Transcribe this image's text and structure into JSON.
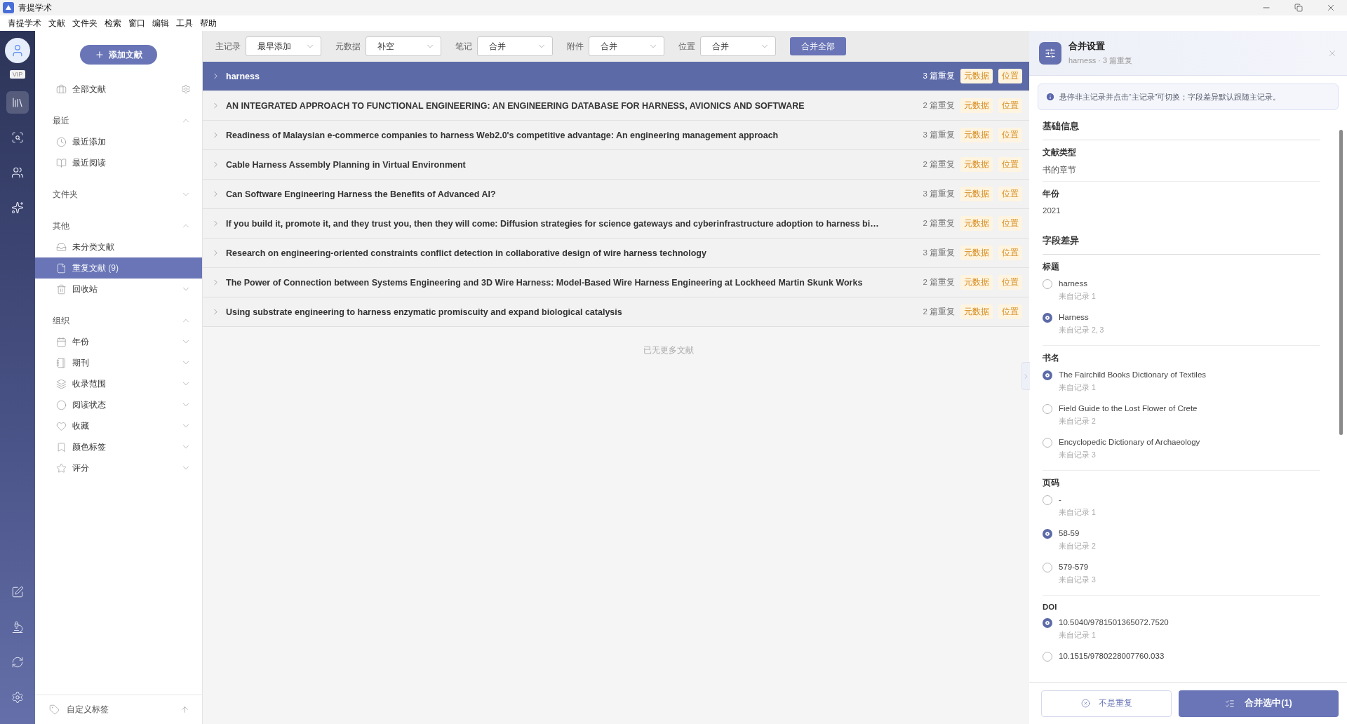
{
  "window": {
    "title": "青提学术"
  },
  "menu": [
    "青提学术",
    "文献",
    "文件夹",
    "检索",
    "窗口",
    "编辑",
    "工具",
    "帮助"
  ],
  "rail": {
    "badge": "VIP",
    "top": [
      {
        "selected": true
      },
      {
        "selected": false
      },
      {
        "selected": false
      },
      {
        "selected": false
      }
    ],
    "bottom": [
      {
        "selected": false
      },
      {
        "selected": false
      },
      {
        "selected": false
      },
      {
        "selected": false
      }
    ]
  },
  "sidebar": {
    "add_button": "添加文献",
    "all_label": "全部文献",
    "sections": [
      {
        "title": "最近",
        "expanded": true,
        "items": [
          {
            "label": "最近添加",
            "selected": false,
            "expandable": false
          },
          {
            "label": "最近阅读",
            "selected": false,
            "expandable": false
          }
        ]
      },
      {
        "title": "文件夹",
        "expanded": false
      },
      {
        "title": "其他",
        "expanded": true,
        "items": [
          {
            "label": "未分类文献",
            "selected": false,
            "expandable": false
          },
          {
            "label": "重复文献",
            "count": "(9)",
            "selected": true,
            "expandable": false
          },
          {
            "label": "回收站",
            "selected": false,
            "expandable": true
          }
        ]
      },
      {
        "title": "组织",
        "expanded": true,
        "items": [
          {
            "label": "年份",
            "selected": false,
            "expandable": true
          },
          {
            "label": "期刊",
            "selected": false,
            "expandable": true
          },
          {
            "label": "收录范围",
            "selected": false,
            "expandable": true
          },
          {
            "label": "阅读状态",
            "selected": false,
            "expandable": true
          },
          {
            "label": "收藏",
            "selected": false,
            "expandable": true
          },
          {
            "label": "颜色标签",
            "selected": false,
            "expandable": true
          },
          {
            "label": "评分",
            "selected": false,
            "expandable": true
          }
        ]
      }
    ],
    "footer": "自定义标签"
  },
  "toolbar": {
    "filters": [
      {
        "label": "主记录",
        "value": "最早添加"
      },
      {
        "label": "元数据",
        "value": "补空"
      },
      {
        "label": "笔记",
        "value": "合并"
      },
      {
        "label": "附件",
        "value": "合并"
      },
      {
        "label": "位置",
        "value": "合并"
      }
    ],
    "merge_all": "合并全部"
  },
  "groups": [
    {
      "title": "harness",
      "count": "3 篇重复",
      "tags": [
        "元数据",
        "位置"
      ],
      "selected": true,
      "expanded": false
    },
    {
      "title": "AN INTEGRATED APPROACH TO FUNCTIONAL ENGINEERING: AN ENGINEERING DATABASE FOR HARNESS, AVIONICS AND SOFTWARE",
      "count": "2 篇重复",
      "tags": [
        "元数据",
        "位置"
      ],
      "selected": false,
      "expanded": false
    },
    {
      "title": "Readiness of Malaysian e-commerce companies to harness Web2.0's competitive advantage: An engineering management approach",
      "count": "3 篇重复",
      "tags": [
        "元数据",
        "位置"
      ],
      "selected": false,
      "expanded": false
    },
    {
      "title": "Cable Harness Assembly Planning in Virtual Environment",
      "count": "2 篇重复",
      "tags": [
        "元数据",
        "位置"
      ],
      "selected": false,
      "expanded": false
    },
    {
      "title": "Can Software Engineering Harness the Benefits of Advanced AI?",
      "count": "3 篇重复",
      "tags": [
        "元数据",
        "位置"
      ],
      "selected": false,
      "expanded": false
    },
    {
      "title": "If you build it, promote it, and they trust you, then they will come: Diffusion strategies for science gateways and cyberinfrastructure adoption to harness bi…",
      "count": "2 篇重复",
      "tags": [
        "元数据",
        "位置"
      ],
      "selected": false,
      "expanded": false
    },
    {
      "title": "Research on engineering-oriented constraints conflict detection in collaborative design of wire harness technology",
      "count": "3 篇重复",
      "tags": [
        "元数据",
        "位置"
      ],
      "selected": false,
      "expanded": false
    },
    {
      "title": "The Power of Connection between Systems Engineering and 3D Wire Harness: Model-Based Wire Harness Engineering at Lockheed Martin Skunk Works",
      "count": "2 篇重复",
      "tags": [
        "元数据",
        "位置"
      ],
      "selected": false,
      "expanded": false
    },
    {
      "title": "Using substrate engineering to harness enzymatic promiscuity and expand biological catalysis",
      "count": "2 篇重复",
      "tags": [
        "元数据",
        "位置"
      ],
      "selected": false,
      "expanded": false
    }
  ],
  "list_end": "已无更多文献",
  "panel": {
    "title": "合并设置",
    "subtitle": "harness · 3 篇重复",
    "notice": "悬停非主记录并点击“主记录”可切换；字段差异默认跟随主记录。",
    "sections": [
      {
        "title": "基础信息",
        "fields": [
          {
            "kind": "info",
            "label": "文献类型",
            "value": "书的章节"
          },
          {
            "kind": "info",
            "label": "年份",
            "value": "2021"
          }
        ]
      },
      {
        "title": "字段差异",
        "fields": [
          {
            "kind": "choice",
            "label": "标题",
            "options": [
              {
                "value": "harness",
                "source": "来自记录 1",
                "selected": false
              },
              {
                "value": "Harness",
                "source": "来自记录 2, 3",
                "selected": true
              }
            ]
          },
          {
            "kind": "choice",
            "label": "书名",
            "options": [
              {
                "value": "The Fairchild Books Dictionary of Textiles",
                "source": "来自记录 1",
                "selected": true
              },
              {
                "value": "Field Guide to the Lost Flower of Crete",
                "source": "来自记录 2",
                "selected": false
              },
              {
                "value": "Encyclopedic Dictionary of Archaeology",
                "source": "来自记录 3",
                "selected": false
              }
            ]
          },
          {
            "kind": "choice",
            "label": "页码",
            "options": [
              {
                "value": "-",
                "source": "来自记录 1",
                "selected": false
              },
              {
                "value": "58-59",
                "source": "来自记录 2",
                "selected": true
              },
              {
                "value": "579-579",
                "source": "来自记录 3",
                "selected": false
              }
            ]
          },
          {
            "kind": "choice",
            "label": "DOI",
            "options": [
              {
                "value": "10.5040/9781501365072.7520",
                "source": "来自记录 1",
                "selected": true
              },
              {
                "value": "10.1515/9780228007760.033",
                "selected": false
              }
            ]
          }
        ]
      }
    ],
    "not_duplicate": "不是重复",
    "merge": "合并选中(1)"
  }
}
